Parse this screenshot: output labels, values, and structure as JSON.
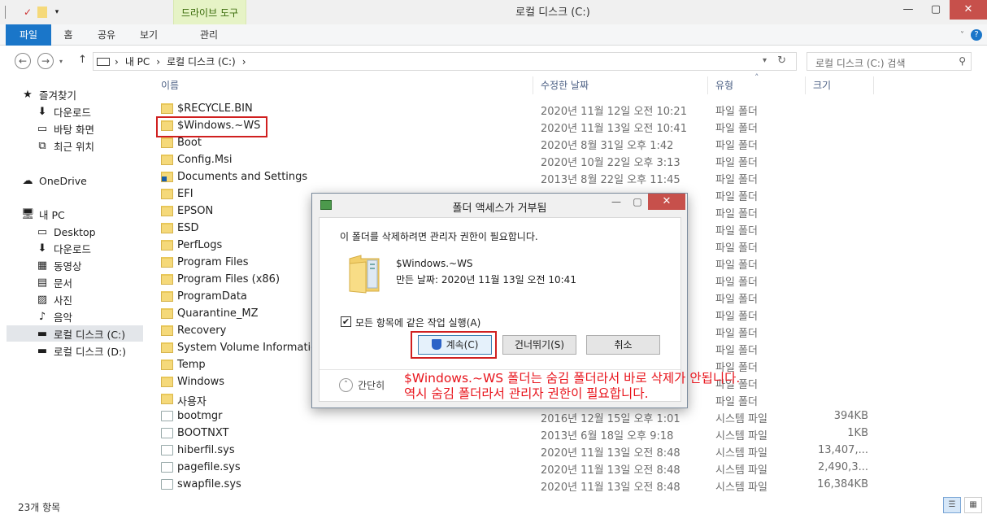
{
  "window": {
    "title": "로컬 디스크 (C:)",
    "context_tab": "드라이브 도구",
    "controls": {
      "minimize": "—",
      "maximize": "▢",
      "close": "✕"
    }
  },
  "ribbon": {
    "tabs": [
      "파일",
      "홈",
      "공유",
      "보기",
      "관리"
    ],
    "help": "?"
  },
  "address": {
    "back": "←",
    "forward": "→",
    "up": "↑",
    "crumbs": [
      "내 PC",
      "›",
      "로컬 디스크 (C:)",
      "›"
    ],
    "first_sep": "›",
    "search_placeholder": "로컬 디스크 (C:) 검색"
  },
  "nav": [
    {
      "label": "즐겨찾기",
      "icon": "★",
      "icon_name": "star-icon"
    },
    {
      "label": "다운로드",
      "icon": "⬇",
      "icon_name": "download-icon"
    },
    {
      "label": "바탕 화면",
      "icon": "▭",
      "icon_name": "desktop-icon"
    },
    {
      "label": "최근 위치",
      "icon": "⧉",
      "icon_name": "recent-icon"
    },
    {
      "label": "OneDrive",
      "icon": "☁",
      "icon_name": "cloud-icon"
    },
    {
      "label": "내 PC",
      "icon": "🖥",
      "icon_name": "computer-icon"
    },
    {
      "label": "Desktop",
      "icon": "▭",
      "icon_name": "desktop-icon"
    },
    {
      "label": "다운로드",
      "icon": "⬇",
      "icon_name": "download-icon"
    },
    {
      "label": "동영상",
      "icon": "▦",
      "icon_name": "video-icon"
    },
    {
      "label": "문서",
      "icon": "▤",
      "icon_name": "document-icon"
    },
    {
      "label": "사진",
      "icon": "▨",
      "icon_name": "picture-icon"
    },
    {
      "label": "음악",
      "icon": "♪",
      "icon_name": "music-icon"
    },
    {
      "label": "로컬 디스크 (C:)",
      "icon": "▬",
      "icon_name": "drive-icon"
    },
    {
      "label": "로컬 디스크 (D:)",
      "icon": "▬",
      "icon_name": "drive-icon"
    }
  ],
  "columns": {
    "name": "이름",
    "date": "수정한 날짜",
    "type": "유형",
    "size": "크기",
    "sort_indicator": "˄"
  },
  "files": [
    {
      "name": "$RECYCLE.BIN",
      "date": "2020년 11월 12일 오전 10:21",
      "type": "파일 폴더",
      "size": ""
    },
    {
      "name": "$Windows.~WS",
      "date": "2020년 11월 13일 오전 10:41",
      "type": "파일 폴더",
      "size": ""
    },
    {
      "name": "Boot",
      "date": "2020년 8월 31일 오후 1:42",
      "type": "파일 폴더",
      "size": ""
    },
    {
      "name": "Config.Msi",
      "date": "2020년 10월 22일 오후 3:13",
      "type": "파일 폴더",
      "size": ""
    },
    {
      "name": "Documents and Settings",
      "date": "2013년 8월 22일 오후 11:45",
      "type": "파일 폴더",
      "size": ""
    },
    {
      "name": "EFI",
      "date": "",
      "type": "파일 폴더",
      "size": ""
    },
    {
      "name": "EPSON",
      "date": "",
      "type": "파일 폴더",
      "size": ""
    },
    {
      "name": "ESD",
      "date": "",
      "type": "파일 폴더",
      "size": ""
    },
    {
      "name": "PerfLogs",
      "date": "",
      "type": "파일 폴더",
      "size": ""
    },
    {
      "name": "Program Files",
      "date": "",
      "type": "파일 폴더",
      "size": ""
    },
    {
      "name": "Program Files (x86)",
      "date": "",
      "type": "파일 폴더",
      "size": ""
    },
    {
      "name": "ProgramData",
      "date": "",
      "type": "파일 폴더",
      "size": ""
    },
    {
      "name": "Quarantine_MZ",
      "date": "",
      "type": "파일 폴더",
      "size": ""
    },
    {
      "name": "Recovery",
      "date": "",
      "type": "파일 폴더",
      "size": ""
    },
    {
      "name": "System Volume Information",
      "date": "",
      "type": "파일 폴더",
      "size": ""
    },
    {
      "name": "Temp",
      "date": "",
      "type": "파일 폴더",
      "size": ""
    },
    {
      "name": "Windows",
      "date": "",
      "type": "파일 폴더",
      "size": ""
    },
    {
      "name": "사용자",
      "date": "",
      "type": "파일 폴더",
      "size": ""
    },
    {
      "name": "bootmgr",
      "date": "2016년 12월 15일 오후 1:01",
      "type": "시스템 파일",
      "size": "394KB"
    },
    {
      "name": "BOOTNXT",
      "date": "2013년 6월 18일 오후 9:18",
      "type": "시스템 파일",
      "size": "1KB"
    },
    {
      "name": "hiberfil.sys",
      "date": "2020년 11월 13일 오전 8:48",
      "type": "시스템 파일",
      "size": "13,407,..."
    },
    {
      "name": "pagefile.sys",
      "date": "2020년 11월 13일 오전 8:48",
      "type": "시스템 파일",
      "size": "2,490,3..."
    },
    {
      "name": "swapfile.sys",
      "date": "2020년 11월 13일 오전 8:48",
      "type": "시스템 파일",
      "size": "16,384KB"
    }
  ],
  "status": {
    "count": "23개 항목"
  },
  "dialog": {
    "title": "폴더 액세스가 거부됨",
    "message": "이 폴더를 삭제하려면 관리자 권한이 필요합니다.",
    "folder_name": "$Windows.~WS",
    "folder_date": "만든 날짜: 2020년 11월 13일 오전 10:41",
    "checkbox_label": "모든 항목에 같은 작업 실행(A)",
    "checkbox_mark": "✔",
    "buttons": {
      "continue": "계속(C)",
      "skip": "건너뛰기(S)",
      "cancel": "취소"
    },
    "brief": "간단히",
    "brief_icon": "˄",
    "controls": {
      "minimize": "—",
      "maximize": "▢",
      "close": "✕"
    }
  },
  "annotation": {
    "line1": "$Windows.~WS 폴더는 숨김 폴더라서 바로 삭제가 안됩니다.",
    "line2": "역시 숨김 폴더라서 관리자 권한이 필요합니다."
  }
}
